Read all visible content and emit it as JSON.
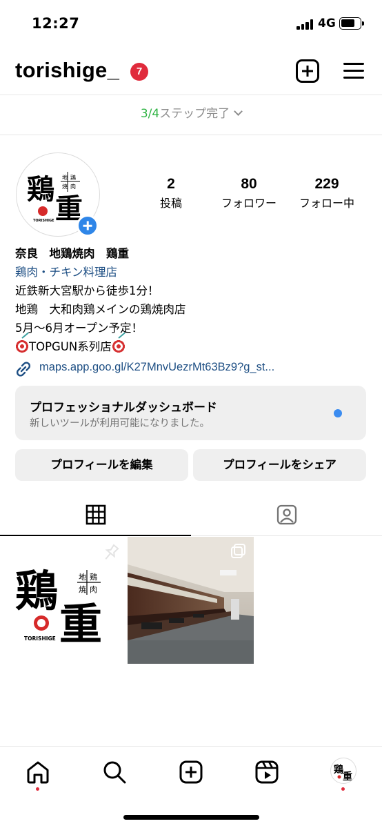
{
  "status_bar": {
    "time": "12:27",
    "network": "4G"
  },
  "header": {
    "username": "torishige_",
    "notification_count": "7"
  },
  "setup": {
    "progress_done": "3/4",
    "progress_label": "ステップ完了"
  },
  "profile": {
    "logo_text": {
      "main1": "鶏",
      "main2": "重",
      "small1": "地",
      "small2": "鶏",
      "small3": "焼",
      "small4": "肉",
      "brand": "TORISHIGE"
    },
    "stats": [
      {
        "value": "2",
        "label": "投稿"
      },
      {
        "value": "80",
        "label": "フォロワー"
      },
      {
        "value": "229",
        "label": "フォロー中"
      }
    ],
    "name": "奈良　地鶏焼肉　鶏重",
    "category": "鶏肉・チキン料理店",
    "bio_lines": [
      "近鉄新大宮駅から徒歩1分！",
      "地鶏　大和肉鶏メインの鶏焼肉店",
      "5月〜6月オープン予定！"
    ],
    "bio_last": "TOPGUN系列店",
    "link": "maps.app.goo.gl/K27MnvUezrMt63Bz9?g_st..."
  },
  "dashboard": {
    "title": "プロフェッショナルダッシュボード",
    "subtitle": "新しいツールが利用可能になりました。"
  },
  "buttons": {
    "edit": "プロフィールを編集",
    "share": "プロフィールをシェア"
  },
  "colors": {
    "accent_link": "#1e4f84",
    "badge_red": "#e02b3c",
    "progress_green": "#2fb344",
    "add_blue": "#2f86e8"
  },
  "icons": [
    "grid-icon",
    "tagged-icon",
    "home-icon",
    "search-icon",
    "create-icon",
    "reels-icon",
    "pin-icon",
    "multi-photo-icon",
    "link-icon",
    "menu-icon"
  ]
}
